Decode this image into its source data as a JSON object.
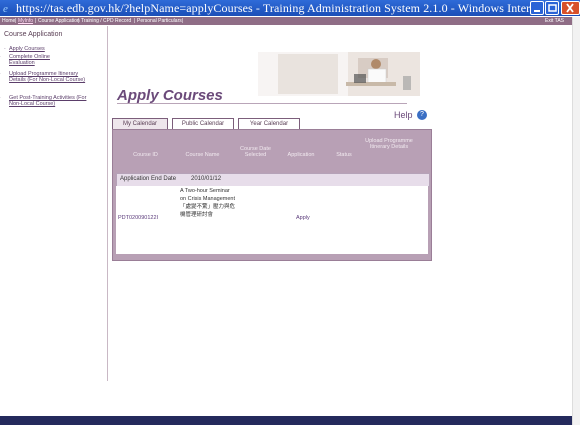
{
  "window": {
    "title": "https://tas.edb.gov.hk/?helpName=applyCourses - Training Administration System 2.1.0 - Windows Interne..."
  },
  "menu": {
    "items": [
      "Home",
      "MyInfo",
      "Course Application",
      "Training / CPD Record",
      "Personal Particulars"
    ],
    "exit": "Exit TAS"
  },
  "sidebar": {
    "title": "Course Application",
    "items": [
      {
        "label": "Apply Courses"
      },
      {
        "label": "Complete Online Evaluation"
      },
      {
        "label": "Upload Programme Itinerary Details (For Non-Local Course)"
      },
      {
        "label": "Get Post-Training Activities (For Non-Local Course)"
      }
    ]
  },
  "page": {
    "title": "Apply Courses",
    "help": "Help"
  },
  "tabs": [
    "My Calendar",
    "Public Calendar",
    "Year Calendar"
  ],
  "table": {
    "headers": [
      "Course ID",
      "Course Name",
      "Course Date Selected",
      "Application",
      "Status",
      "Upload Programme Itinerary Details"
    ],
    "end_label": "Application End Date",
    "end_date": "2010/01/12",
    "row": {
      "course_id": "PDT020090122I",
      "course_name": "A Two-hour Seminar on Crisis Management 「處變不驚」壓力與危機管理研討會",
      "application": "Apply"
    }
  },
  "colors": {
    "accent": "#6b4a7a",
    "menu": "#8f6d86",
    "panel": "#b8a0b5"
  }
}
